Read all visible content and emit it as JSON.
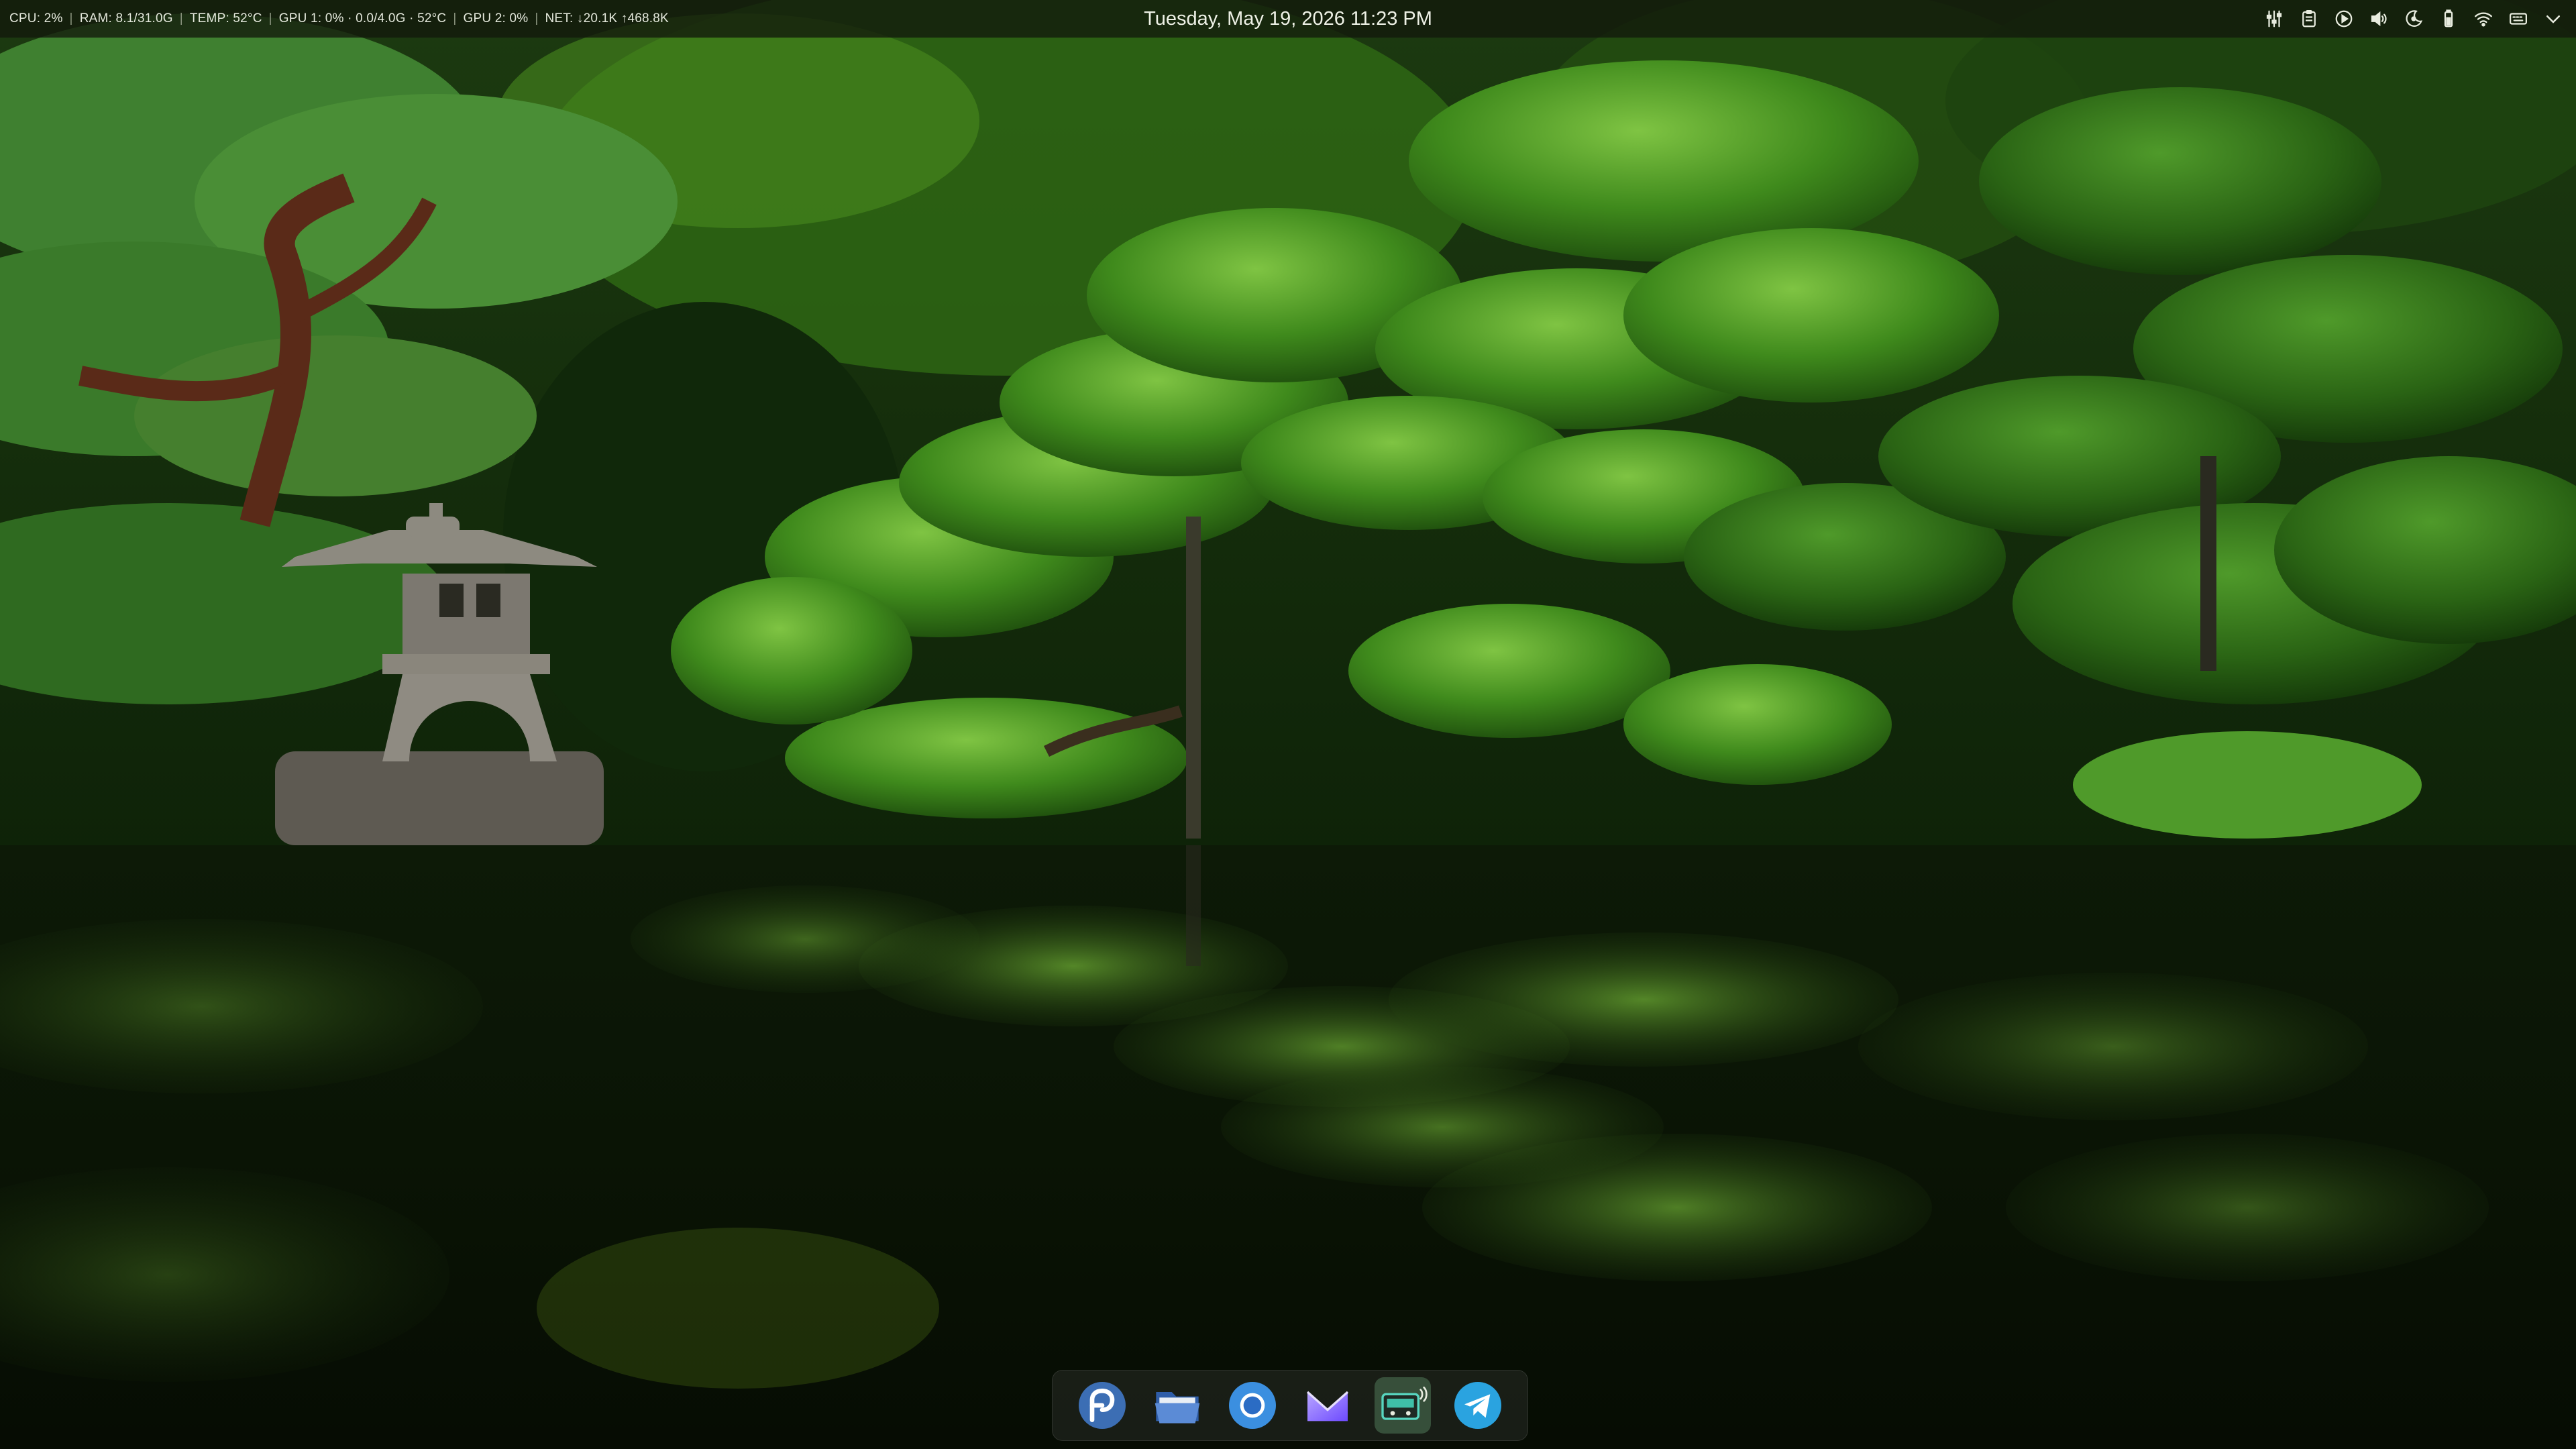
{
  "topbar": {
    "stats": {
      "cpu": "CPU: 2%",
      "ram": "RAM: 8.1/31.0G",
      "temp": "TEMP: 52°C",
      "gpu1": "GPU 1: 0% · 0.0/4.0G · 52°C",
      "gpu2": "GPU 2: 0%",
      "net": "NET: ↓20.1K ↑468.8K"
    },
    "clock": "Tuesday, May 19, 2026 11:23 PM",
    "tray": [
      "mixer-icon",
      "clipboard-icon",
      "media-play-icon",
      "volume-icon",
      "night-light-icon",
      "battery-icon",
      "wifi-icon",
      "keyboard-layout-icon",
      "chevron-down-icon"
    ]
  },
  "dock": {
    "apps": [
      "fedora-icon",
      "file-manager-icon",
      "chromium-icon",
      "proton-mail-icon",
      "audio-recorder-icon",
      "telegram-icon"
    ],
    "active_index": 4
  },
  "colors": {
    "accent_blue": "#3b8fe0",
    "foliage": "#3f8a1c",
    "water": "#0c1707"
  }
}
